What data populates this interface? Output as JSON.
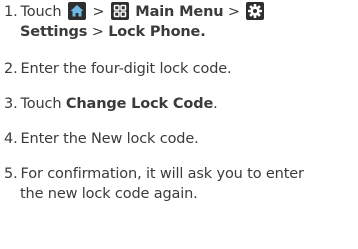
{
  "steps": [
    {
      "number": "1.",
      "text_a": "Touch",
      "sep_1": ">",
      "main_menu": "Main Menu",
      "sep_2": ">",
      "settings": "Settings",
      "sep_3": ">",
      "lock_phone": "Lock Phone."
    },
    {
      "number": "2.",
      "text": "Enter the four-digit lock code."
    },
    {
      "number": "3.",
      "text_a": "Touch",
      "bold": "Change Lock Code",
      "text_b": "."
    },
    {
      "number": "4.",
      "text": "Enter the New lock code."
    },
    {
      "number": "5.",
      "line_1": "For confirmation, it will ask you to enter",
      "line_2": "the new lock code again."
    }
  ],
  "icons": {
    "home": "home-icon",
    "menu": "main-menu-icon",
    "settings": "settings-gear-icon"
  },
  "colors": {
    "text": "#3b3b3b",
    "icon_bg": "#2e2e2e",
    "icon_fg": "#ffffff",
    "home_fg": "#6fb8e6"
  }
}
